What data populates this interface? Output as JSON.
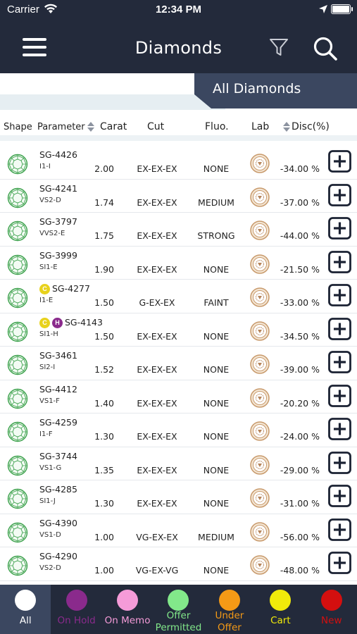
{
  "status_bar": {
    "carrier": "Carrier",
    "time": "12:34 PM"
  },
  "nav": {
    "title": "Diamonds"
  },
  "banner": {
    "label": "All Diamonds"
  },
  "table_header": {
    "shape": "Shape",
    "parameter": "Parameter",
    "carat": "Carat",
    "cut": "Cut",
    "fluo": "Fluo.",
    "lab": "Lab",
    "disc": "Disc(%)"
  },
  "rows": [
    {
      "stock": "SG-4426",
      "clarity": "I1-I",
      "carat": "2.00",
      "cut": "EX-EX-EX",
      "fluo": "NONE",
      "disc": "-34.00 %"
    },
    {
      "stock": "SG-4241",
      "clarity": "VS2-D",
      "carat": "1.74",
      "cut": "EX-EX-EX",
      "fluo": "MEDIUM",
      "disc": "-37.00 %"
    },
    {
      "stock": "SG-3797",
      "clarity": "VVS2-E",
      "carat": "1.75",
      "cut": "EX-EX-EX",
      "fluo": "STRONG",
      "disc": "-44.00 %"
    },
    {
      "stock": "SG-3999",
      "clarity": "SI1-E",
      "carat": "1.90",
      "cut": "EX-EX-EX",
      "fluo": "NONE",
      "disc": "-21.50 %"
    },
    {
      "stock": "SG-4277",
      "clarity": "I1-E",
      "carat": "1.50",
      "cut": "G-EX-EX",
      "fluo": "FAINT",
      "disc": "-33.00 %",
      "badges": [
        "C"
      ]
    },
    {
      "stock": "SG-4143",
      "clarity": "SI1-H",
      "carat": "1.50",
      "cut": "EX-EX-EX",
      "fluo": "NONE",
      "disc": "-34.50 %",
      "badges": [
        "C",
        "H"
      ]
    },
    {
      "stock": "SG-3461",
      "clarity": "SI2-I",
      "carat": "1.52",
      "cut": "EX-EX-EX",
      "fluo": "NONE",
      "disc": "-39.00 %"
    },
    {
      "stock": "SG-4412",
      "clarity": "VS1-F",
      "carat": "1.40",
      "cut": "EX-EX-EX",
      "fluo": "NONE",
      "disc": "-20.20 %"
    },
    {
      "stock": "SG-4259",
      "clarity": "I1-F",
      "carat": "1.30",
      "cut": "EX-EX-EX",
      "fluo": "NONE",
      "disc": "-24.00 %"
    },
    {
      "stock": "SG-3744",
      "clarity": "VS1-G",
      "carat": "1.35",
      "cut": "EX-EX-EX",
      "fluo": "NONE",
      "disc": "-29.00 %"
    },
    {
      "stock": "SG-4285",
      "clarity": "SI1-J",
      "carat": "1.30",
      "cut": "EX-EX-EX",
      "fluo": "NONE",
      "disc": "-31.00 %"
    },
    {
      "stock": "SG-4390",
      "clarity": "VS1-D",
      "carat": "1.00",
      "cut": "VG-EX-EX",
      "fluo": "MEDIUM",
      "disc": "-56.00 %"
    },
    {
      "stock": "SG-4290",
      "clarity": "VS2-D",
      "carat": "1.00",
      "cut": "VG-EX-VG",
      "fluo": "NONE",
      "disc": "-48.00 %"
    }
  ],
  "badge_colors": {
    "C": "#e8d21c",
    "H": "#8a2a8c"
  },
  "tabs": [
    {
      "label": "All",
      "color": "#ffffff",
      "label_color": "#ffffff",
      "active": true
    },
    {
      "label": "On Hold",
      "color": "#8a2a8c",
      "label_color": "#8a2a8c"
    },
    {
      "label": "On Memo",
      "color": "#f59bd8",
      "label_color": "#f59bd8"
    },
    {
      "label": "Offer Permitted",
      "color": "#82e88a",
      "label_color": "#82e88a"
    },
    {
      "label": "Under Offer",
      "color": "#f59a16",
      "label_color": "#f59a16"
    },
    {
      "label": "Cart",
      "color": "#f0ea0a",
      "label_color": "#f0ea0a"
    },
    {
      "label": "New",
      "color": "#d40f0f",
      "label_color": "#d40f0f"
    }
  ],
  "icons": {
    "menu": "hamburger-icon",
    "filter": "filter-icon",
    "search": "search-icon",
    "shape": "round-diamond-icon",
    "lab": "lab-certificate-icon",
    "add": "plus-square-icon"
  }
}
